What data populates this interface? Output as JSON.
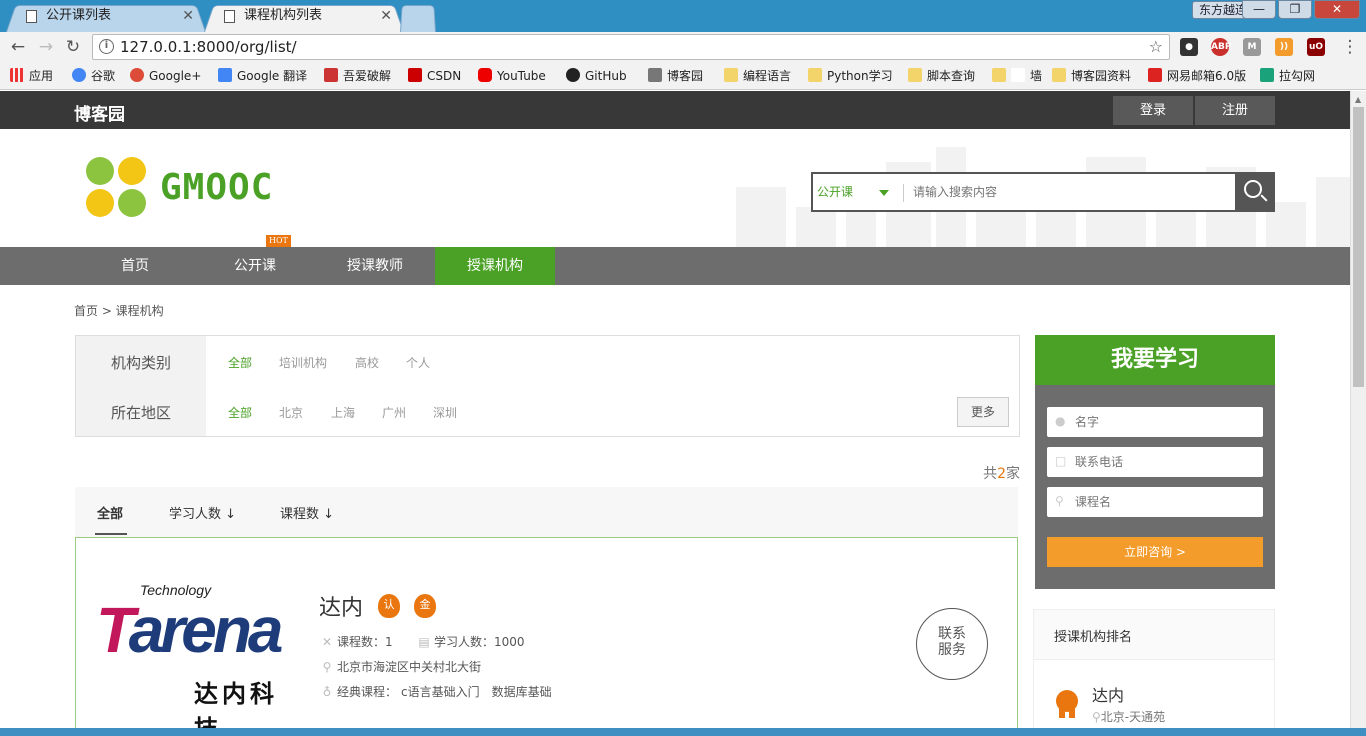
{
  "browser": {
    "tabs": [
      {
        "title": "公开课列表",
        "active": false
      },
      {
        "title": "课程机构列表",
        "active": true
      }
    ],
    "ime_label": "东方越连",
    "url": "127.0.0.1:8000/org/list/",
    "bookmarks": [
      "应用",
      "谷歌",
      "Google+",
      "Google 翻译",
      "吾爱破解",
      "CSDN",
      "YouTube",
      "GitHub",
      "博客园",
      "编程语言",
      "Python学习",
      "脚本查询",
      "墙",
      "博客园资料",
      "网易邮箱6.0版",
      "拉勾网"
    ],
    "extensions": [
      "ABP",
      "uO"
    ]
  },
  "topbar": {
    "brand": "博客园",
    "login": "登录",
    "register": "注册"
  },
  "header": {
    "logo_text": "GMOOC",
    "search": {
      "category": "公开课",
      "placeholder": "请输入搜索内容"
    }
  },
  "nav": {
    "items": [
      "首页",
      "公开课",
      "授课教师",
      "授课机构"
    ],
    "active_index": 3,
    "hot_badge": "HOT"
  },
  "breadcrumb": "首页 > 课程机构",
  "filters": {
    "category": {
      "label": "机构类别",
      "options": [
        "全部",
        "培训机构",
        "高校",
        "个人"
      ],
      "selected": "全部"
    },
    "region": {
      "label": "所在地区",
      "options": [
        "全部",
        "北京",
        "上海",
        "广州",
        "深圳"
      ],
      "selected": "全部"
    },
    "more": "更多"
  },
  "total": {
    "prefix": "共",
    "count": "2",
    "suffix": "家"
  },
  "sort": {
    "all": "全部",
    "students": "学习人数 ↓",
    "courses": "课程数 ↓"
  },
  "org": {
    "logo": {
      "tech": "Technology",
      "brand_first": "T",
      "brand_rest": "arena",
      "cn": "达内科技"
    },
    "name": "达内",
    "badges": [
      "认",
      "金"
    ],
    "course_count": "课程数：1",
    "student_count": "学习人数：1000",
    "address": "北京市海淀区中关村北大街",
    "classic_label": "经典课程：",
    "classic_courses": [
      "c语言基础入门",
      "数据库基础"
    ],
    "contact_line1": "联系",
    "contact_line2": "服务"
  },
  "learn_form": {
    "title": "我要学习",
    "name_placeholder": "名字",
    "phone_placeholder": "联系电话",
    "course_placeholder": "课程名",
    "submit": "立即咨询 >"
  },
  "ranking": {
    "title": "授课机构排名",
    "items": [
      {
        "name": "达内",
        "address": "北京-天通苑"
      }
    ]
  },
  "colors": {
    "brand_green": "#4aa126",
    "accent_orange": "#f39c2b",
    "dark_bar": "#383838",
    "nav_gray": "#6d6d6d"
  }
}
